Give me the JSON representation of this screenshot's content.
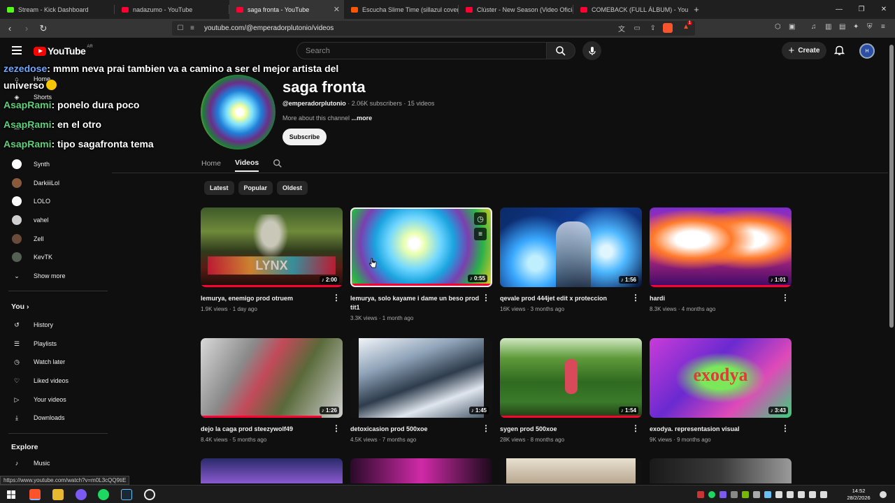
{
  "browser": {
    "tabs": [
      {
        "title": "Stream - Kick Dashboard",
        "color": "#53fc18"
      },
      {
        "title": "nadazumo - YouTube",
        "color": "#ff0033"
      },
      {
        "title": "saga fronta - YouTube",
        "color": "#ff0033",
        "active": true
      },
      {
        "title": "Escucha Slime Time (sillazul cover) de",
        "color": "#ff5500"
      },
      {
        "title": "Clúster - New Season (Video Oficial)",
        "color": "#ff0033"
      },
      {
        "title": "COMEBACK (FULL ÁLBUM) - YouTube",
        "color": "#ff0033"
      }
    ],
    "url": "youtube.com/@emperadorplutonio/videos",
    "brave_badge": "1"
  },
  "header": {
    "logo": "YouTube",
    "country": "AR",
    "search_placeholder": "Search",
    "create_label": "Create",
    "avatar_text": "H"
  },
  "sidebar": {
    "top": [
      {
        "label": "Home",
        "icon": "home-icon"
      },
      {
        "label": "Shorts",
        "icon": "shorts-icon"
      },
      {
        "label": "Subscriptions",
        "icon": "subscriptions-icon"
      }
    ],
    "subscriptions": [
      {
        "label": "Synth",
        "color": "#ffffff"
      },
      {
        "label": "DarkiiiLol",
        "color": "#8a5a3c"
      },
      {
        "label": "LOLO",
        "color": "#ffffff"
      },
      {
        "label": "vahel",
        "color": "#cfcfcf"
      },
      {
        "label": "Zell",
        "color": "#6b4a3a"
      },
      {
        "label": "KevTK",
        "color": "#556055"
      }
    ],
    "show_more": "Show more",
    "you_heading": "You",
    "you_items": [
      {
        "label": "History",
        "icon": "history-icon"
      },
      {
        "label": "Playlists",
        "icon": "playlists-icon"
      },
      {
        "label": "Watch later",
        "icon": "watch-later-icon"
      },
      {
        "label": "Liked videos",
        "icon": "liked-icon"
      },
      {
        "label": "Your videos",
        "icon": "your-videos-icon"
      },
      {
        "label": "Downloads",
        "icon": "download-icon"
      }
    ],
    "explore_heading": "Explore",
    "explore_items": [
      {
        "label": "Music",
        "icon": "music-icon"
      }
    ]
  },
  "chat_overlay": [
    {
      "user": "zezedose",
      "message": ": mmm neva prai tambien va a camino a ser el mejor artista del"
    },
    {
      "user": "",
      "message": "universo"
    },
    {
      "user": "AsapRami",
      "message": ": ponelo dura poco"
    },
    {
      "user": "AsapRami",
      "message": ": en el otro"
    },
    {
      "user": "AsapRami",
      "message": ": tipo sagafronta tema"
    }
  ],
  "channel": {
    "name": "saga fronta",
    "handle": "@emperadorplutonio",
    "stats": " · 2.06K subscribers · 15 videos",
    "about": "More about this channel ",
    "about_more": "...more",
    "subscribe": "Subscribe",
    "tabs": [
      "Home",
      "Videos"
    ],
    "active_tab": "Videos",
    "chips": [
      "Latest",
      "Popular",
      "Oldest"
    ]
  },
  "videos": [
    {
      "title": "lemurya, enemigo prod otruem",
      "views": "1.9K views",
      "age": "1 day ago",
      "duration": "2:00",
      "progress": 1.0
    },
    {
      "title": "lemurya, solo kayame i dame un beso prod tit1",
      "views": "3.3K views",
      "age": "1 month ago",
      "duration": "0:55",
      "progress": 1.0
    },
    {
      "title": "qevale prod 444jet edit x proteccion",
      "views": "16K views",
      "age": "3 months ago",
      "duration": "1:56",
      "progress": 0
    },
    {
      "title": "hardi",
      "views": "8.3K views",
      "age": "4 months ago",
      "duration": "1:01",
      "progress": 1.0
    },
    {
      "title": "dejo la caga prod steezywolf49",
      "views": "8.4K views",
      "age": "5 months ago",
      "duration": "1:26",
      "progress": 0.85
    },
    {
      "title": "detoxicasion prod 500xoe",
      "views": "4.5K views",
      "age": "7 months ago",
      "duration": "1:45",
      "progress": 0
    },
    {
      "title": "sygen prod 500xoe",
      "views": "28K views",
      "age": "8 months ago",
      "duration": "1:54",
      "progress": 1.0
    },
    {
      "title": "exodya. representasion visual",
      "views": "9K views",
      "age": "9 months ago",
      "duration": "3:43",
      "progress": 0
    }
  ],
  "thumb_text": {
    "t1": "LYNX",
    "t8": "exodya"
  },
  "status_url": "https://www.youtube.com/watch?v=m0L3cQQ9tiE",
  "clock": {
    "time": "14:52",
    "date": "28/2/2026"
  }
}
